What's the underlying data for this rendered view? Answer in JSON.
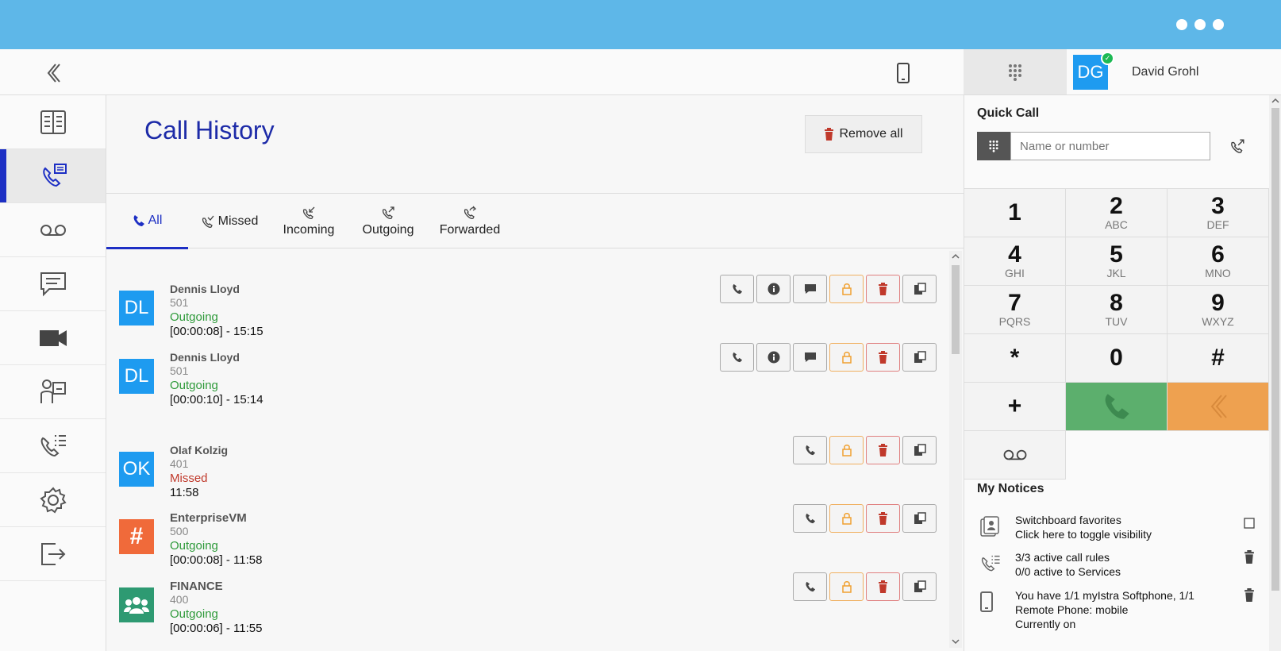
{
  "header": {
    "user_initials": "DG",
    "user_name": "David Grohl"
  },
  "sidebar": {
    "items": [
      {
        "name": "contacts"
      },
      {
        "name": "call-history",
        "active": true
      },
      {
        "name": "voicemail"
      },
      {
        "name": "messages"
      },
      {
        "name": "video"
      },
      {
        "name": "switchboard"
      },
      {
        "name": "call-rules"
      },
      {
        "name": "settings"
      },
      {
        "name": "logout"
      }
    ]
  },
  "main": {
    "title": "Call History",
    "remove_all_label": "Remove all",
    "tabs": [
      {
        "label": "All",
        "active": true
      },
      {
        "label": "Missed"
      },
      {
        "label": "Incoming"
      },
      {
        "label": "Outgoing"
      },
      {
        "label": "Forwarded"
      }
    ],
    "entries": [
      {
        "initials": "DL",
        "name": "Dennis Lloyd",
        "number": "501",
        "type": "Outgoing",
        "time": "[00:00:08] - 15:15"
      },
      {
        "initials": "DL",
        "name": "Dennis Lloyd",
        "number": "501",
        "type": "Outgoing",
        "time": "[00:00:10] - 15:14"
      },
      {
        "initials": "OK",
        "name": "Olaf Kolzig",
        "number": "401",
        "type": "Missed",
        "time": "11:58"
      },
      {
        "initials": "#",
        "name": "EnterpriseVM",
        "number": "500",
        "type": "Outgoing",
        "time": "[00:00:08] - 11:58"
      },
      {
        "initials": "",
        "name": "FINANCE",
        "number": "400",
        "type": "Outgoing",
        "time": "[00:00:06] - 11:55"
      }
    ]
  },
  "quick_call": {
    "title": "Quick Call",
    "placeholder": "Name or number",
    "keys": [
      {
        "n": "1",
        "l": ""
      },
      {
        "n": "2",
        "l": "ABC"
      },
      {
        "n": "3",
        "l": "DEF"
      },
      {
        "n": "4",
        "l": "GHI"
      },
      {
        "n": "5",
        "l": "JKL"
      },
      {
        "n": "6",
        "l": "MNO"
      },
      {
        "n": "7",
        "l": "PQRS"
      },
      {
        "n": "8",
        "l": "TUV"
      },
      {
        "n": "9",
        "l": "WXYZ"
      },
      {
        "n": "*",
        "l": ""
      },
      {
        "n": "0",
        "l": ""
      },
      {
        "n": "#",
        "l": ""
      },
      {
        "n": "+",
        "l": ""
      }
    ]
  },
  "notices": {
    "title": "My Notices",
    "items": [
      {
        "line1": "Switchboard favorites",
        "line2": "Click here to toggle visibility"
      },
      {
        "line1": "3/3 active call rules",
        "line2": "0/0 active to Services"
      },
      {
        "line1": "You have 1/1 myIstra Softphone, 1/1",
        "line2": "Remote Phone: mobile",
        "line3": "Currently on"
      }
    ]
  },
  "colors": {
    "accent": "#1d2fc4",
    "topbar": "#5eb7e8",
    "outgoing": "#2e9a3a",
    "missed": "#c0392b",
    "avatar_blue": "#1e9bf0",
    "avatar_orange": "#f06a3a",
    "avatar_green": "#2e9a72",
    "call_green": "#5caf6d",
    "back_orange": "#eea150"
  }
}
